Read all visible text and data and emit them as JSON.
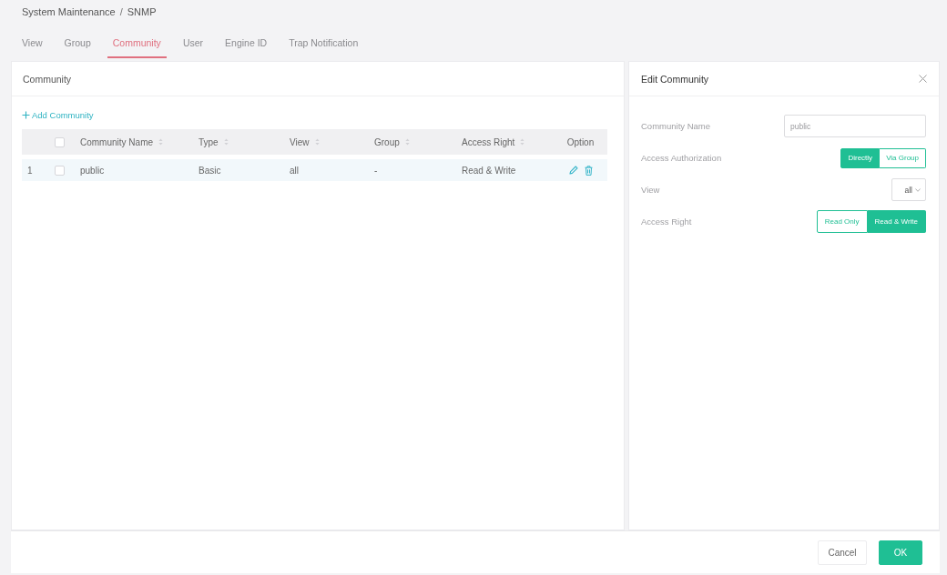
{
  "breadcrumb": {
    "items": [
      "System Maintenance",
      "SNMP"
    ],
    "separator": "/"
  },
  "tabs": [
    {
      "label": "View",
      "selected": false
    },
    {
      "label": "Group",
      "selected": false
    },
    {
      "label": "Community",
      "selected": true
    },
    {
      "label": "User",
      "selected": false
    },
    {
      "label": "Engine ID",
      "selected": false
    },
    {
      "label": "Trap Notification",
      "selected": false
    }
  ],
  "community_panel": {
    "title": "Community",
    "add_link": "Add Community",
    "table": {
      "all_checked": false,
      "columns": [
        {
          "label": "Community Name",
          "sortable": true,
          "kind": "text"
        },
        {
          "label": "Type",
          "sortable": true,
          "kind": "text"
        },
        {
          "label": "View",
          "sortable": true,
          "kind": "text"
        },
        {
          "label": "Group",
          "sortable": true,
          "kind": "text"
        },
        {
          "label": "Access Right",
          "sortable": true,
          "kind": "text"
        },
        {
          "label": "Option",
          "sortable": false,
          "kind": "actions"
        }
      ],
      "rows": [
        {
          "index": "1",
          "checked": false,
          "selected": true,
          "cells": [
            "public",
            "Basic",
            "all",
            "-",
            "Read & Write"
          ]
        }
      ]
    }
  },
  "edit_panel": {
    "title": "Edit Community",
    "fields": [
      {
        "kind": "text",
        "label": "Community Name",
        "placeholder": "public"
      },
      {
        "kind": "segmented",
        "label": "Access Authorization",
        "options": [
          {
            "label": "Directly",
            "selected": true
          },
          {
            "label": "Via Group",
            "selected": false
          }
        ]
      },
      {
        "kind": "select",
        "label": "View",
        "value": "all"
      },
      {
        "kind": "segmented",
        "label": "Access Right",
        "options": [
          {
            "label": "Read Only",
            "selected": false
          },
          {
            "label": "Read & Write",
            "selected": true
          }
        ]
      }
    ]
  },
  "footer": {
    "buttons": [
      {
        "label": "Cancel",
        "kind": "secondary"
      },
      {
        "label": "OK",
        "kind": "primary"
      }
    ]
  }
}
